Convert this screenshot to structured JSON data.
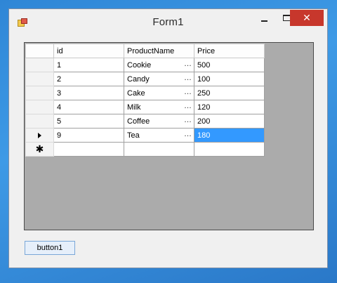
{
  "window": {
    "title": "Form1",
    "close_label": "✕"
  },
  "grid": {
    "columns": [
      "id",
      "ProductName",
      "Price"
    ],
    "rows": [
      {
        "id": "1",
        "name": "Cookie",
        "price": "500"
      },
      {
        "id": "2",
        "name": "Candy",
        "price": "100"
      },
      {
        "id": "3",
        "name": "Cake",
        "price": "250"
      },
      {
        "id": "4",
        "name": "Milk",
        "price": "120"
      },
      {
        "id": "5",
        "name": "Coffee",
        "price": "200"
      },
      {
        "id": "9",
        "name": "Tea",
        "price": "180"
      }
    ],
    "ellipsis": "…",
    "new_row_marker": "✱",
    "current_row_index": 5,
    "selected_cell": "price",
    "selection_color": "#3399ff"
  },
  "button1": {
    "label": "button1"
  },
  "colors": {
    "close_button": "#c7372c",
    "grid_background": "#ababab",
    "desktop": "#3e9ae6"
  }
}
